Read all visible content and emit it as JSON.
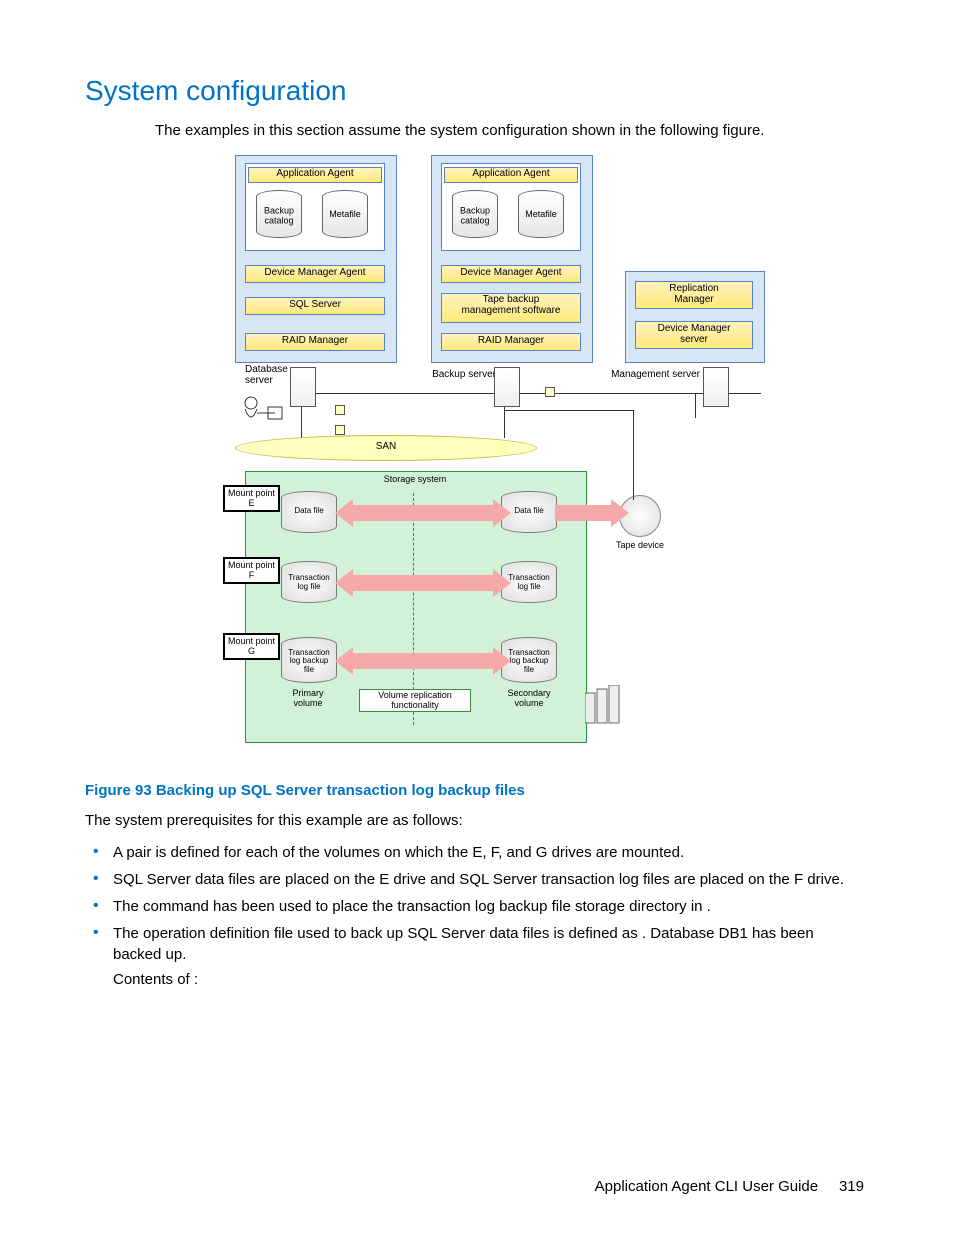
{
  "heading": "System configuration",
  "intro": "The examples in this section assume the system configuration shown in the following figure.",
  "diagram": {
    "db_server": {
      "app_agent": "Application Agent",
      "backup_catalog": "Backup\ncatalog",
      "metafile": "Metafile",
      "dev_mgr_agent": "Device Manager Agent",
      "sql_server": "SQL Server",
      "raid_manager": "RAID Manager",
      "label": "Database\nserver"
    },
    "backup_server": {
      "app_agent": "Application Agent",
      "backup_catalog": "Backup\ncatalog",
      "metafile": "Metafile",
      "dev_mgr_agent": "Device Manager Agent",
      "tape_sw": "Tape backup\nmanagement software",
      "raid_manager": "RAID Manager",
      "label": "Backup server"
    },
    "mgmt_server": {
      "rep_mgr": "Replication\nManager",
      "dev_mgr_srv": "Device Manager\nserver",
      "label": "Management server"
    },
    "san": "SAN",
    "storage": {
      "label": "Storage system",
      "mp_e": "Mount point\nE",
      "mp_f": "Mount point\nF",
      "mp_g": "Mount point\nG",
      "data_file": "Data file",
      "txn_log": "Transaction\nlog file",
      "txn_bk": "Transaction\nlog backup\nfile",
      "primary": "Primary\nvolume",
      "vrf": "Volume replication\nfunctionality",
      "secondary": "Secondary\nvolume"
    },
    "tape_device": "Tape device"
  },
  "caption": "Figure 93 Backing up SQL Server transaction log backup files",
  "prereq_intro": "The system prerequisites for this example are as follows:",
  "bullets": [
    "A pair is defined for each of the volumes on which the E, F, and G drives are mounted.",
    "SQL Server data files are placed on the E drive and SQL Server transaction log files are placed on the F drive.",
    "The                              command has been used to place the transaction log backup file storage directory in                                    .",
    "The operation definition file used to back up SQL Server data files is defined as           . Database DB1 has been backed up."
  ],
  "contents_of": "Contents of                         :",
  "footer_title": "Application Agent CLI User Guide",
  "page_number": "319"
}
